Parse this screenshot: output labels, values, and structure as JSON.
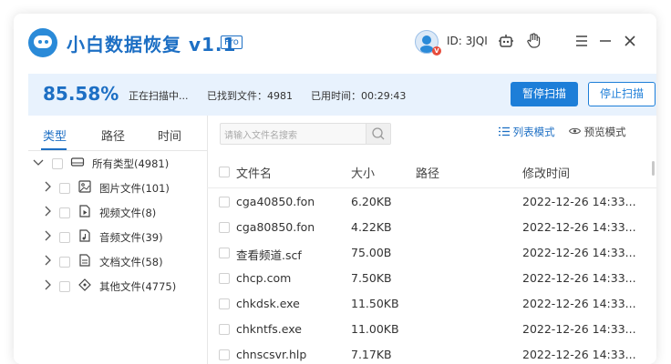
{
  "app": {
    "title": "小白数据恢复 v1.1",
    "badge": "Pro",
    "user_id": "ID: 3JQI",
    "avatar_badge": "V"
  },
  "titlebar_icons": [
    "robot-icon",
    "hand-pointer-icon",
    "menu-icon",
    "minimize-icon",
    "close-icon"
  ],
  "status": {
    "percent": "85.58%",
    "scanning": "正在扫描中...",
    "found": "已找到文件：4981",
    "elapsed": "已用时间：00:29:43",
    "pause_label": "暂停扫描",
    "stop_label": "停止扫描"
  },
  "left_tabs": [
    "类型",
    "路径",
    "时间"
  ],
  "tree": [
    {
      "label": "所有类型(4981)",
      "icon": "drive-icon",
      "expanded": true
    },
    {
      "label": "图片文件(101)",
      "icon": "image-icon"
    },
    {
      "label": "视频文件(8)",
      "icon": "video-icon"
    },
    {
      "label": "音频文件(39)",
      "icon": "audio-icon"
    },
    {
      "label": "文档文件(58)",
      "icon": "document-icon"
    },
    {
      "label": "其他文件(4775)",
      "icon": "other-icon"
    }
  ],
  "search": {
    "placeholder": "请输入文件名搜索"
  },
  "view_modes": {
    "list": "列表模式",
    "preview": "预览模式"
  },
  "columns": [
    "文件名",
    "大小",
    "路径",
    "修改时间"
  ],
  "files": [
    {
      "name": "cga40850.fon",
      "size": "6.20KB",
      "path": "",
      "modified": "2022-12-26 14:33..."
    },
    {
      "name": "cga80850.fon",
      "size": "4.22KB",
      "path": "",
      "modified": "2022-12-26 14:33..."
    },
    {
      "name": "查看频道.scf",
      "size": "75.00B",
      "path": "",
      "modified": "2022-12-26 14:33..."
    },
    {
      "name": "chcp.com",
      "size": "7.50KB",
      "path": "",
      "modified": "2022-12-26 14:33..."
    },
    {
      "name": "chkdsk.exe",
      "size": "11.50KB",
      "path": "",
      "modified": "2022-12-26 14:33..."
    },
    {
      "name": "chkntfs.exe",
      "size": "11.00KB",
      "path": "",
      "modified": "2022-12-26 14:33..."
    },
    {
      "name": "chnscsvr.hlp",
      "size": "7.17KB",
      "path": "",
      "modified": "2022-12-26 14:33..."
    }
  ],
  "colors": {
    "accent": "#1d7ed8",
    "status_bg": "#e8f2fd"
  }
}
